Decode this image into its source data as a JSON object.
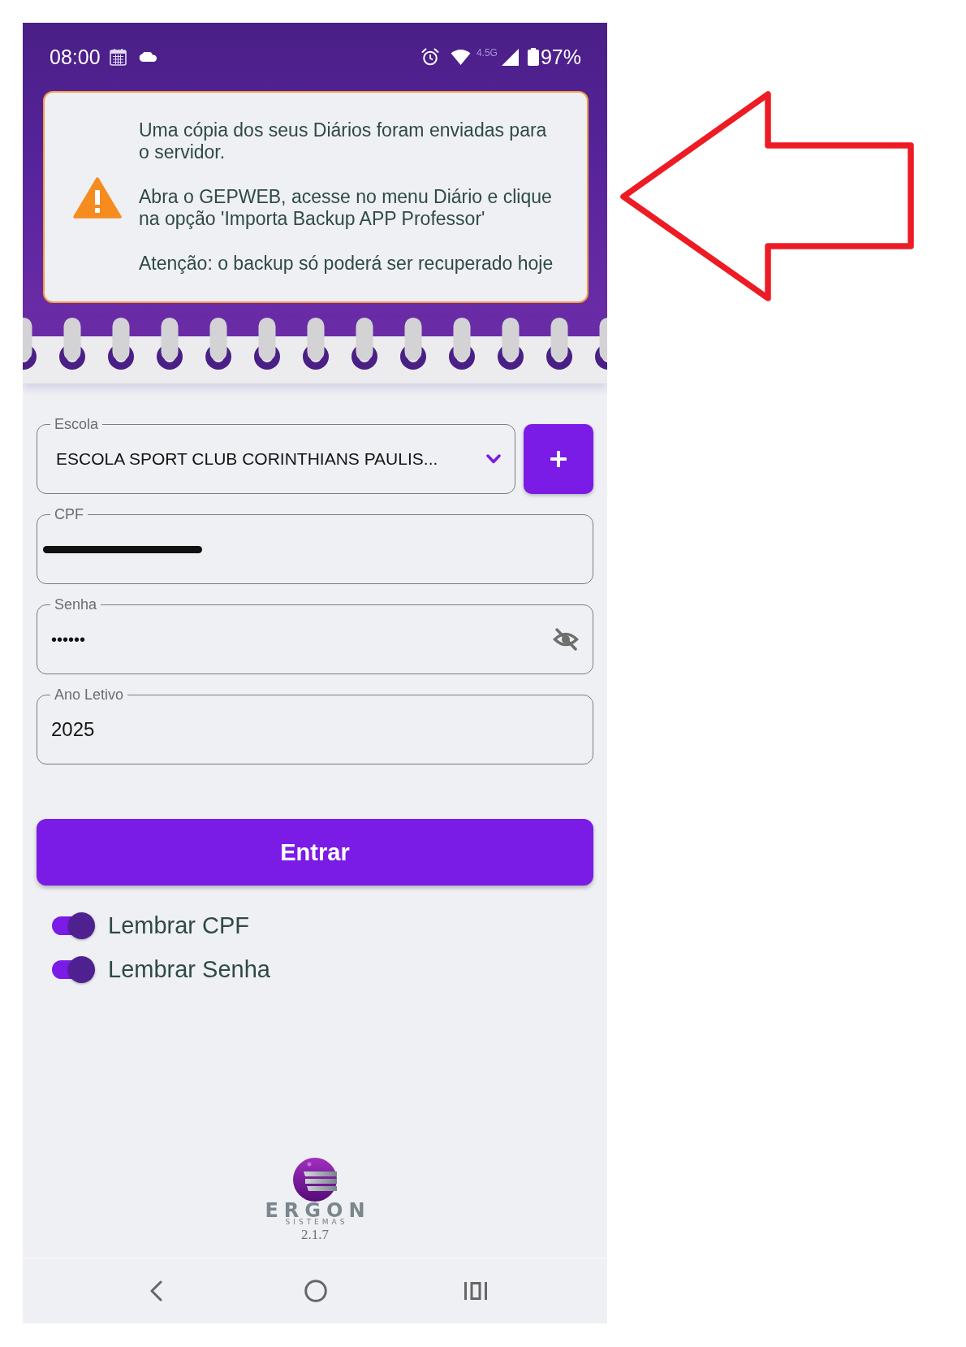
{
  "status_bar": {
    "time": "08:00",
    "network": "4.5G",
    "battery": "97%"
  },
  "alert": {
    "messages": [
      "Uma cópia dos seus Diários foram enviadas para o servidor.",
      "Abra o GEPWEB, acesse no menu Diário e clique na opção 'Importa Backup APP Professor'",
      "Atenção: o backup só poderá ser recuperado hoje"
    ]
  },
  "form": {
    "fields": [
      {
        "kind": "select",
        "label": "Escola",
        "value": "ESCOLA SPORT CLUB CORINTHIANS PAULIS..."
      },
      {
        "kind": "redacted",
        "label": "CPF"
      },
      {
        "kind": "password",
        "label": "Senha",
        "value": "••••••"
      },
      {
        "kind": "text",
        "label": "Ano Letivo",
        "value": "2025"
      }
    ],
    "submit_button": "Entrar",
    "toggles": [
      {
        "label": "Lembrar CPF",
        "on": true
      },
      {
        "label": "Lembrar Senha",
        "on": true
      }
    ]
  },
  "footer": {
    "logo_name": "ERGON",
    "logo_tagline": "SISTEMAS",
    "version": "2.1.7"
  }
}
